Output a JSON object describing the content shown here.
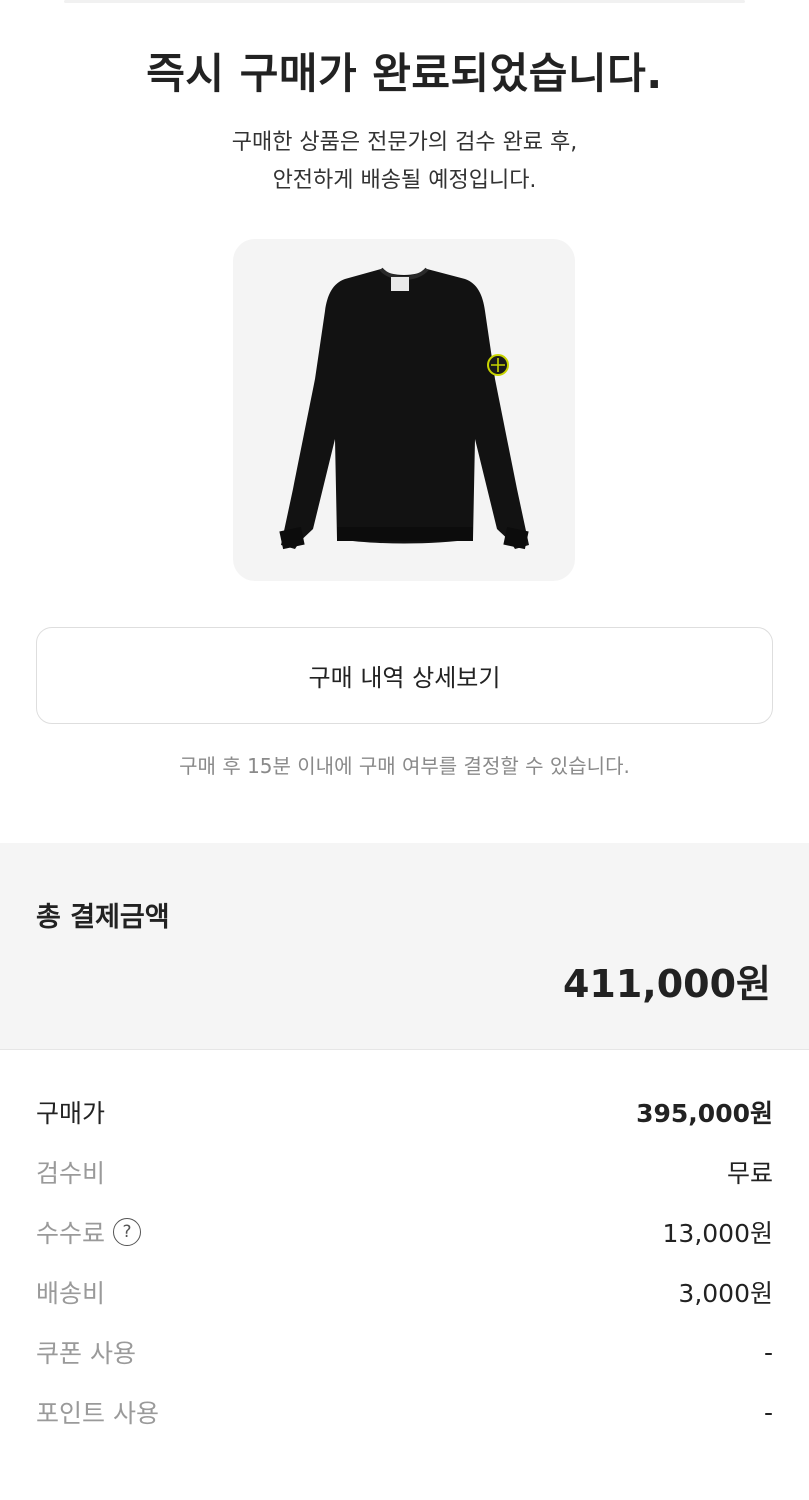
{
  "header": {
    "title": "즉시 구매가 완료되었습니다.",
    "subtitle_line1": "구매한 상품은 전문가의 검수 완료 후,",
    "subtitle_line2": "안전하게 배송될 예정입니다."
  },
  "product": {
    "image_icon": "sweatshirt-image",
    "garment_color": "#111111",
    "badge_color": "#c8d400"
  },
  "actions": {
    "detail_button_label": "구매 내역 상세보기",
    "notice": "구매 후 15분 이내에 구매 여부를 결정할 수 있습니다."
  },
  "summary": {
    "total_label": "총 결제금액",
    "total_amount": "411,000원",
    "items": [
      {
        "label": "구매가",
        "value": "395,000원"
      },
      {
        "label": "검수비",
        "value": "무료"
      },
      {
        "label": "수수료",
        "value": "13,000원",
        "help_icon": "?"
      },
      {
        "label": "배송비",
        "value": "3,000원"
      },
      {
        "label": "쿠폰 사용",
        "value": "-"
      },
      {
        "label": "포인트 사용",
        "value": "-"
      }
    ]
  }
}
